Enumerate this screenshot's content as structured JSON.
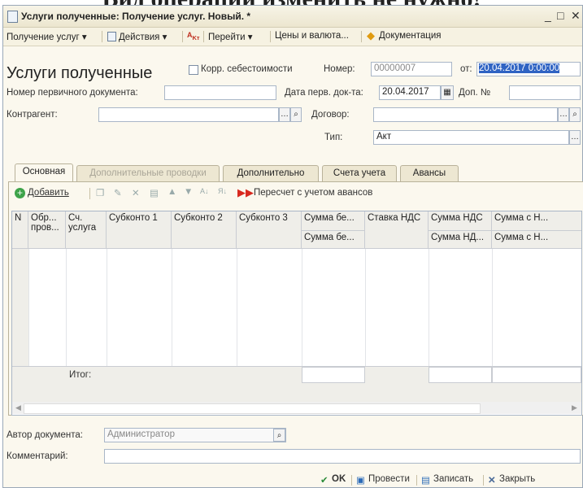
{
  "heading": "Вид операции изменить не нужно!",
  "window": {
    "title": "Услуги полученные: Получение услуг. Новый. *"
  },
  "menu": {
    "items": [
      "Получение услуг ▾",
      "Действия ▾",
      "Перейти ▾",
      "Цены и валюта...",
      "Документация"
    ]
  },
  "form": {
    "title": "Услуги полученные",
    "corr_cost_label": "Корр. себестоимости",
    "number_label": "Номер:",
    "number_value": "00000007",
    "from_label": "от:",
    "date_value": "20.04.2017 0:00:00",
    "primary_doc_label": "Номер первичного документа:",
    "primary_doc_value": "",
    "primary_date_label": "Дата перв. док-та:",
    "primary_date_value": "20.04.2017",
    "extra_no_label": "Доп. №",
    "counterparty_label": "Контрагент:",
    "contract_label": "Договор:",
    "type_label": "Тип:",
    "type_value": "Акт"
  },
  "tabs": [
    "Основная",
    "Дополнительные проводки",
    "Дополнительно",
    "Счета учета",
    "Авансы"
  ],
  "table_toolbar": {
    "add_label": "Добавить",
    "recalc_label": "Пересчет с учетом авансов"
  },
  "table": {
    "headers": [
      "N",
      "Обр... пров...",
      "Сч. услуга",
      "Субконто 1",
      "Субконто 2",
      "Субконто 3",
      "Сумма бе...",
      "Ставка НДС",
      "Сумма НДС",
      "Сумма с Н..."
    ],
    "subheaders": {
      "sum_wo": "Сумма бе...",
      "vat_sum": "Сумма НД...",
      "sum_with": "Сумма с Н..."
    },
    "total_label": "Итог:"
  },
  "footer": {
    "author_label": "Автор документа:",
    "author_value": "Администратор",
    "comment_label": "Комментарий:",
    "comment_value": ""
  },
  "buttons": {
    "ok": "OK",
    "post": "Провести",
    "save": "Записать",
    "close": "Закрыть"
  }
}
